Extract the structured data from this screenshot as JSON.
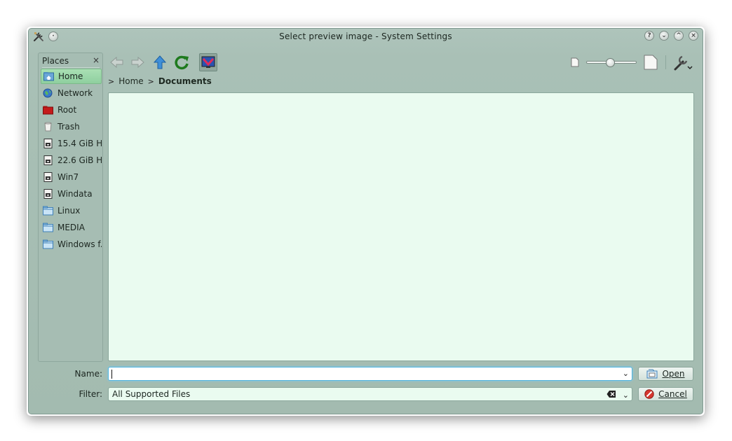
{
  "window": {
    "title": "Select preview image - System Settings",
    "buttons": [
      "?",
      "⌄",
      "^",
      "×"
    ]
  },
  "places": {
    "title": "Places",
    "close_label": "×",
    "items": [
      {
        "label": "Home",
        "icon": "home-folder-icon",
        "selected": true
      },
      {
        "label": "Network",
        "icon": "network-globe-icon"
      },
      {
        "label": "Root",
        "icon": "red-folder-icon"
      },
      {
        "label": "Trash",
        "icon": "trash-icon"
      },
      {
        "label": "15.4 GiB H...",
        "icon": "drive-icon"
      },
      {
        "label": "22.6 GiB H...",
        "icon": "drive-icon"
      },
      {
        "label": "Win7",
        "icon": "drive-icon"
      },
      {
        "label": "Windata",
        "icon": "drive-icon"
      },
      {
        "label": "Linux",
        "icon": "blue-folder-icon"
      },
      {
        "label": "MEDIA",
        "icon": "blue-folder-icon"
      },
      {
        "label": "Windows f...",
        "icon": "blue-folder-icon"
      }
    ]
  },
  "breadcrumb": {
    "sep": ">",
    "items": [
      "Home",
      "Documents"
    ]
  },
  "zoom": {
    "level": 0.45
  },
  "form": {
    "name_label": "Name:",
    "name_value": "",
    "filter_label": "Filter:",
    "filter_value": "All Supported Files",
    "open_label": "Open",
    "cancel_label": "Cancel"
  },
  "colors": {
    "accent_selected": "#8fcf9f",
    "view_bg": "#eafbf0",
    "focus": "#4fb3df"
  }
}
